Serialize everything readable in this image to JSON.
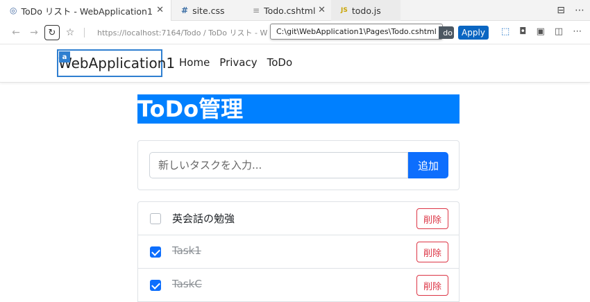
{
  "tabs": [
    {
      "icon": "globe-icon",
      "glyph": "◎",
      "label": "ToDo リスト - WebApplication1",
      "close": "✕"
    },
    {
      "icon": "hash-icon",
      "glyph": "#",
      "label": "site.css"
    },
    {
      "icon": "file-icon",
      "glyph": "≡",
      "label": "Todo.cshtml",
      "close": "✕"
    },
    {
      "icon": "js-icon",
      "glyph": "JS",
      "label": "todo.js"
    }
  ],
  "address": {
    "url": "https://localhost:7164/Todo / ToDo リスト - W",
    "tooltip": "C:\\git\\WebApplication1\\Pages\\Todo.cshtml",
    "do_label": "do",
    "apply_label": "Apply"
  },
  "navbar": {
    "brand": "WebApplication1",
    "badge": "a",
    "links": [
      "Home",
      "Privacy",
      "ToDo"
    ]
  },
  "page": {
    "title": "ToDo管理",
    "input_placeholder": "新しいタスクを入力...",
    "add_label": "追加"
  },
  "todos": [
    {
      "text": "英会話の勉強",
      "done": false,
      "delete_label": "削除"
    },
    {
      "text": "Task1",
      "done": true,
      "delete_label": "削除"
    },
    {
      "text": "TaskC",
      "done": true,
      "delete_label": "削除"
    }
  ],
  "colors": {
    "title_bg": "#0080ff",
    "primary": "#0d6efd",
    "danger": "#dc3545",
    "apply": "#0a66c2"
  }
}
